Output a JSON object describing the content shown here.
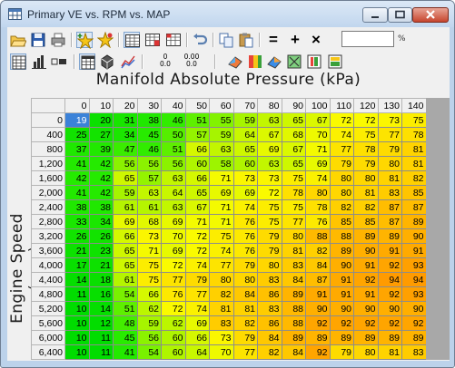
{
  "window": {
    "title": "Primary VE vs. RPM vs. MAP"
  },
  "toolbar1": {
    "icons": [
      "folder-open-icon",
      "save-icon",
      "print-icon",
      "star-add-icon",
      "star-icon",
      "table-view-icon",
      "table-edit-icon",
      "table-refresh-icon",
      "undo-icon",
      "copy-icon",
      "paste-icon"
    ],
    "ops": [
      "=",
      "+",
      "×"
    ],
    "value": "",
    "unit": "%"
  },
  "toolbar2": {
    "icons": [
      "grid-icon",
      "chart-icon",
      "table-small-icon",
      "table-icon",
      "3d-view-icon",
      "surface-icon",
      "decimal-left-icon",
      "decimal-right-icon",
      "color-map-1-icon",
      "color-map-2-icon",
      "color-map-3-icon",
      "color-map-4-icon",
      "color-map-5-icon",
      "color-map-6-icon"
    ],
    "decimal_left_top": "0",
    "decimal_left_bottom": "0.0",
    "decimal_right_top": "0.00",
    "decimal_right_bottom": "0.0"
  },
  "table": {
    "x_title": "Manifold Absolute Pressure (kPa)",
    "y_title": "Engine Speed (rpm)",
    "columns": [
      "0",
      "10",
      "20",
      "30",
      "40",
      "50",
      "60",
      "70",
      "80",
      "90",
      "100",
      "110",
      "120",
      "130",
      "140"
    ],
    "rows": [
      {
        "rpm": "0",
        "values": [
          "19",
          "20",
          "31",
          "38",
          "46",
          "51",
          "55",
          "59",
          "63",
          "65",
          "67",
          "72",
          "72",
          "73",
          "75"
        ]
      },
      {
        "rpm": "400",
        "values": [
          "25",
          "27",
          "34",
          "45",
          "50",
          "57",
          "59",
          "64",
          "67",
          "68",
          "70",
          "74",
          "75",
          "77",
          "78"
        ]
      },
      {
        "rpm": "800",
        "values": [
          "37",
          "39",
          "47",
          "46",
          "51",
          "66",
          "63",
          "65",
          "69",
          "67",
          "71",
          "77",
          "78",
          "79",
          "81"
        ]
      },
      {
        "rpm": "1,200",
        "values": [
          "41",
          "42",
          "56",
          "56",
          "56",
          "60",
          "58",
          "60",
          "63",
          "65",
          "69",
          "79",
          "79",
          "80",
          "81"
        ]
      },
      {
        "rpm": "1,600",
        "values": [
          "42",
          "42",
          "65",
          "57",
          "63",
          "66",
          "71",
          "73",
          "73",
          "75",
          "74",
          "80",
          "80",
          "81",
          "82"
        ]
      },
      {
        "rpm": "2,000",
        "values": [
          "41",
          "42",
          "59",
          "63",
          "64",
          "65",
          "69",
          "69",
          "72",
          "78",
          "80",
          "80",
          "81",
          "83",
          "85"
        ]
      },
      {
        "rpm": "2,400",
        "values": [
          "38",
          "38",
          "61",
          "61",
          "63",
          "67",
          "71",
          "74",
          "75",
          "75",
          "78",
          "82",
          "82",
          "87",
          "87"
        ]
      },
      {
        "rpm": "2,800",
        "values": [
          "33",
          "34",
          "69",
          "68",
          "69",
          "71",
          "71",
          "76",
          "75",
          "77",
          "76",
          "85",
          "85",
          "87",
          "89"
        ]
      },
      {
        "rpm": "3,200",
        "values": [
          "26",
          "26",
          "66",
          "73",
          "70",
          "72",
          "75",
          "76",
          "79",
          "80",
          "88",
          "88",
          "89",
          "89",
          "90"
        ]
      },
      {
        "rpm": "3,600",
        "values": [
          "21",
          "23",
          "65",
          "71",
          "69",
          "72",
          "74",
          "76",
          "79",
          "81",
          "82",
          "89",
          "90",
          "91",
          "91"
        ]
      },
      {
        "rpm": "4,000",
        "values": [
          "17",
          "21",
          "65",
          "75",
          "72",
          "74",
          "77",
          "79",
          "80",
          "83",
          "84",
          "90",
          "91",
          "92",
          "93"
        ]
      },
      {
        "rpm": "4,400",
        "values": [
          "14",
          "18",
          "61",
          "75",
          "77",
          "79",
          "80",
          "80",
          "83",
          "84",
          "87",
          "91",
          "92",
          "94",
          "94"
        ]
      },
      {
        "rpm": "4,800",
        "values": [
          "11",
          "16",
          "54",
          "66",
          "76",
          "77",
          "82",
          "84",
          "86",
          "89",
          "91",
          "91",
          "91",
          "92",
          "93"
        ]
      },
      {
        "rpm": "5,200",
        "values": [
          "10",
          "14",
          "51",
          "62",
          "72",
          "74",
          "81",
          "81",
          "83",
          "88",
          "90",
          "90",
          "90",
          "90",
          "90"
        ]
      },
      {
        "rpm": "5,600",
        "values": [
          "10",
          "12",
          "48",
          "59",
          "62",
          "69",
          "83",
          "82",
          "86",
          "88",
          "92",
          "92",
          "92",
          "92",
          "92"
        ]
      },
      {
        "rpm": "6,000",
        "values": [
          "10",
          "11",
          "45",
          "56",
          "60",
          "66",
          "73",
          "79",
          "84",
          "89",
          "89",
          "89",
          "89",
          "89",
          "89"
        ]
      },
      {
        "rpm": "6,400",
        "values": [
          "10",
          "11",
          "41",
          "54",
          "60",
          "64",
          "70",
          "77",
          "82",
          "84",
          "92",
          "79",
          "80",
          "81",
          "83"
        ]
      }
    ],
    "selected": "0,0"
  },
  "colors": {
    "low": "#2a8cff",
    "mid": "#00e000",
    "high": "#ff9e00"
  }
}
